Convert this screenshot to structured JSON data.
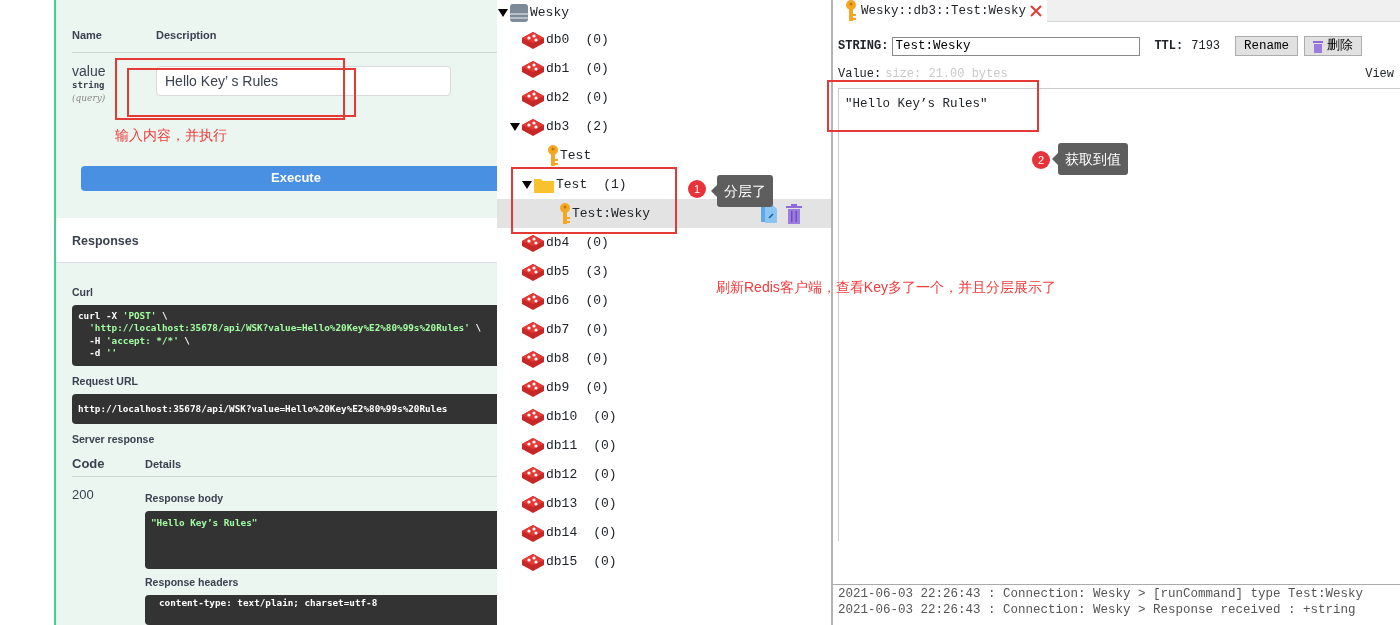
{
  "swagger": {
    "param_headers": [
      "Name",
      "Description"
    ],
    "param": {
      "name": "value",
      "type": "string",
      "location": "(query)",
      "value": "Hello Key’ s Rules"
    },
    "execute_label": "Execute",
    "responses_title": "Responses",
    "curl_label": "Curl",
    "curl_lines": [
      [
        {
          "kind": "plain",
          "text": "curl -X "
        },
        {
          "kind": "string",
          "text": "'POST'"
        },
        {
          "kind": "plain",
          "text": " \\"
        }
      ],
      [
        {
          "kind": "string",
          "text": "  'http://localhost:35678/api/WSK?value=Hello%20Key%E2%80%99s%20Rules'"
        },
        {
          "kind": "plain",
          "text": " \\"
        }
      ],
      [
        {
          "kind": "plain",
          "text": "  -H "
        },
        {
          "kind": "string",
          "text": "'accept: */*'"
        },
        {
          "kind": "plain",
          "text": " \\"
        }
      ],
      [
        {
          "kind": "plain",
          "text": "  -d "
        },
        {
          "kind": "string",
          "text": "''"
        }
      ]
    ],
    "request_url_label": "Request URL",
    "request_url": "http://localhost:35678/api/WSK?value=Hello%20Key%E2%80%99s%20Rules",
    "server_response_label": "Server response",
    "code_header": "Code",
    "details_header": "Details",
    "code": "200",
    "response_body_label": "Response body",
    "response_body": "\"Hello Key’s Rules\"",
    "response_headers_label": "Response headers",
    "response_headers": "content-type: text/plain; charset=utf-8"
  },
  "tree": [
    {
      "kind": "server",
      "label": "Wesky",
      "expanded": true,
      "selected": false,
      "children": [
        {
          "kind": "db",
          "label": "db0",
          "count": "(0)",
          "selected": false
        },
        {
          "kind": "db",
          "label": "db1",
          "count": "(0)",
          "selected": false
        },
        {
          "kind": "db",
          "label": "db2",
          "count": "(0)",
          "selected": false
        },
        {
          "kind": "db",
          "label": "db3",
          "count": "(2)",
          "expanded": true,
          "selected": false,
          "children": [
            {
              "kind": "key",
              "label": "Test",
              "selected": false
            },
            {
              "kind": "folder",
              "label": "Test",
              "count": "(1)",
              "expanded": true,
              "selected": false,
              "children": [
                {
                  "kind": "key",
                  "label": "Test:Wesky",
                  "selected": true
                }
              ]
            }
          ]
        },
        {
          "kind": "db",
          "label": "db4",
          "count": "(0)",
          "selected": false
        },
        {
          "kind": "db",
          "label": "db5",
          "count": "(3)",
          "selected": false
        },
        {
          "kind": "db",
          "label": "db6",
          "count": "(0)",
          "selected": false
        },
        {
          "kind": "db",
          "label": "db7",
          "count": "(0)",
          "selected": false
        },
        {
          "kind": "db",
          "label": "db8",
          "count": "(0)",
          "selected": false
        },
        {
          "kind": "db",
          "label": "db9",
          "count": "(0)",
          "selected": false
        },
        {
          "kind": "db",
          "label": "db10",
          "count": "(0)",
          "selected": false
        },
        {
          "kind": "db",
          "label": "db11",
          "count": "(0)",
          "selected": false
        },
        {
          "kind": "db",
          "label": "db12",
          "count": "(0)",
          "selected": false
        },
        {
          "kind": "db",
          "label": "db13",
          "count": "(0)",
          "selected": false
        },
        {
          "kind": "db",
          "label": "db14",
          "count": "(0)",
          "selected": false
        },
        {
          "kind": "db",
          "label": "db15",
          "count": "(0)",
          "selected": false
        }
      ]
    }
  ],
  "key_tab": {
    "title": "Wesky::db3::Test:Wesky"
  },
  "key_editor": {
    "type_label": "STRING:",
    "key_name": "Test:Wesky",
    "ttl_label": "TTL:",
    "ttl": "7193",
    "rename_label": "Rename",
    "delete_label": "删除",
    "value_label": "Value:",
    "size": "size: 21.00 bytes",
    "view_label": "View",
    "value": "\"Hello Key’s Rules\""
  },
  "log": [
    "2021-06-03 22:26:43 : Connection: Wesky > [runCommand] type Test:Wesky",
    "2021-06-03 22:26:43 : Connection: Wesky > Response received : +string"
  ],
  "annotations": {
    "notes": [
      "输入内容，并执行",
      "刷新Redis客户端，查看Key多了一个，并且分层展示了"
    ],
    "callouts": [
      {
        "number": "1",
        "text": "分层了"
      },
      {
        "number": "2",
        "text": "获取到值"
      }
    ]
  }
}
